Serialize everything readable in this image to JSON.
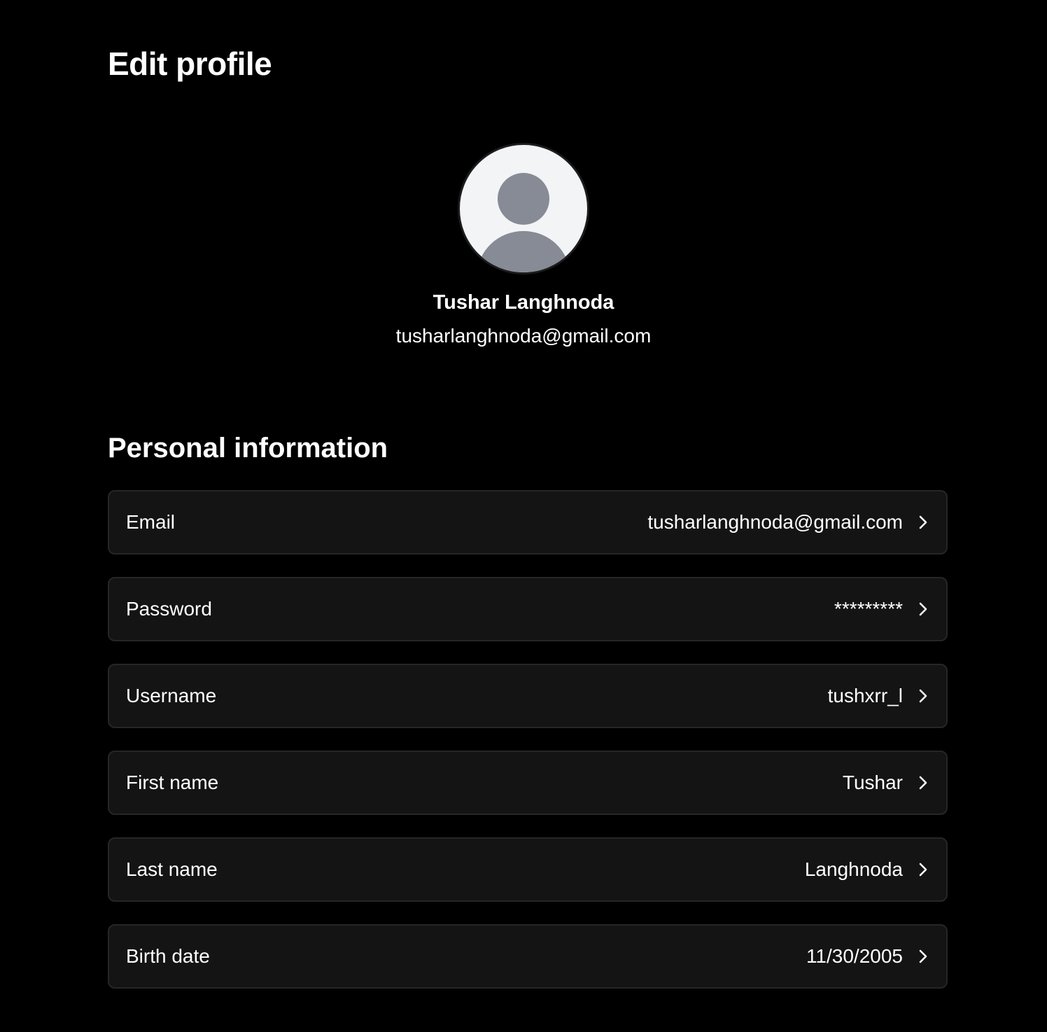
{
  "page": {
    "title": "Edit profile"
  },
  "profile": {
    "name": "Tushar Langhnoda",
    "email": "tusharlanghnoda@gmail.com",
    "avatar_icon": "default-user-avatar"
  },
  "personal_info": {
    "heading": "Personal information",
    "rows": [
      {
        "label": "Email",
        "value": "tusharlanghnoda@gmail.com",
        "icon": "chevron-right-icon"
      },
      {
        "label": "Password",
        "value": "*********",
        "icon": "chevron-right-icon"
      },
      {
        "label": "Username",
        "value": "tushxrr_l",
        "icon": "chevron-right-icon"
      },
      {
        "label": "First name",
        "value": "Tushar",
        "icon": "chevron-right-icon"
      },
      {
        "label": "Last name",
        "value": "Langhnoda",
        "icon": "chevron-right-icon"
      },
      {
        "label": "Birth date",
        "value": "11/30/2005",
        "icon": "chevron-right-icon"
      }
    ]
  },
  "colors": {
    "background": "#000000",
    "row_background": "#141414",
    "row_border": "#262626",
    "text": "#ffffff",
    "avatar_background": "#f3f4f6",
    "avatar_figure": "#868b95"
  }
}
